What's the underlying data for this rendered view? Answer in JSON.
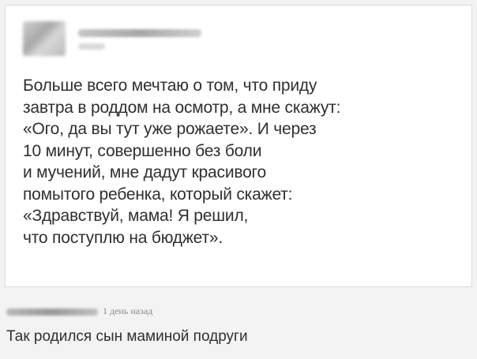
{
  "post": {
    "author_blurred": true,
    "lines": [
      "Больше всего мечтаю о том, что приду",
      "завтра в роддом на осмотр, а мне скажут:",
      "«Ого, да вы тут уже рожаете». И через",
      "10 минут, совершенно без боли",
      "и мучений, мне дадут красивого",
      "помытого ребенка, который скажет:",
      "«Здравствуй, мама! Я решил,",
      "что поступлю на бюджет»."
    ]
  },
  "comment": {
    "commenter_blurred": true,
    "time": "1 день назад",
    "text": "Так родился сын маминой подруги"
  }
}
